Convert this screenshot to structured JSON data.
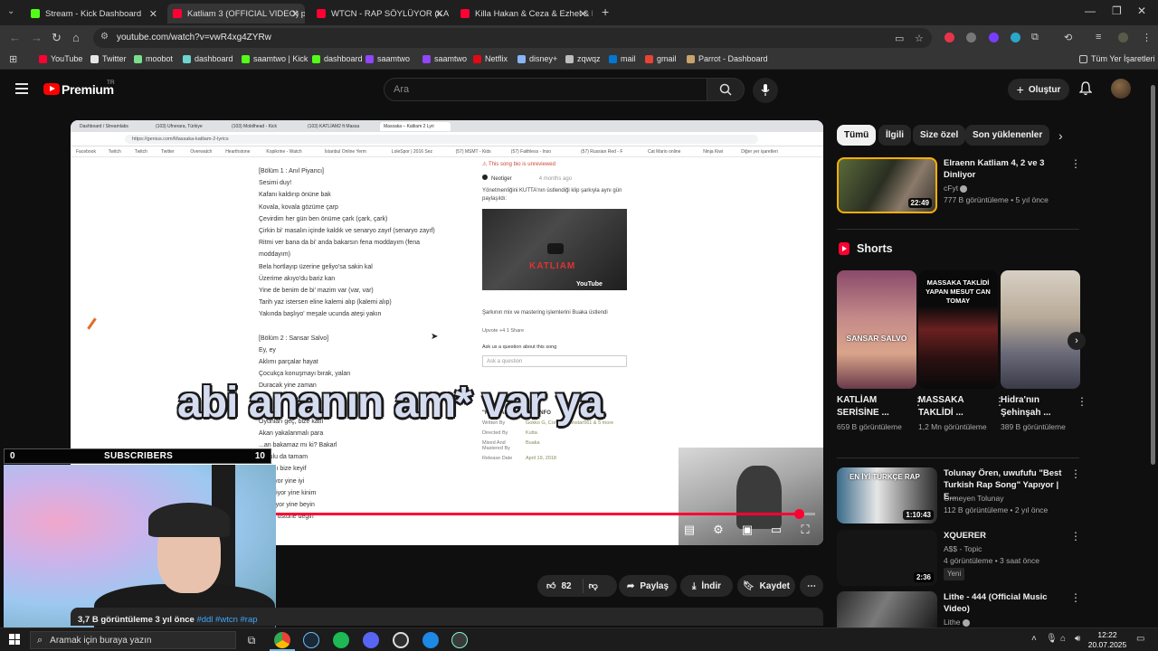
{
  "browser": {
    "tabs": [
      {
        "title": "Stream - Kick Dashboard",
        "active": false,
        "color": "#53fc18"
      },
      {
        "title": "Katliam 3 (OFFICIAL VIDEO) pro",
        "active": true,
        "color": "#ff0033"
      },
      {
        "title": "WTCN - RAP SÖYLÜYOR (KATLİ",
        "active": false,
        "color": "#ff0033"
      },
      {
        "title": "Killa Hakan & Ceza & Ezhel & B",
        "active": false,
        "color": "#ff0033"
      }
    ],
    "url": "youtube.com/watch?v=vwR4xg4ZYRw",
    "bookmarks": [
      {
        "label": "YouTube",
        "color": "#ff0033"
      },
      {
        "label": "Twitter",
        "color": "#e6e6e6"
      },
      {
        "label": "moobot",
        "color": "#7adf8a"
      },
      {
        "label": "dashboard",
        "color": "#6fd3d0"
      },
      {
        "label": "saamtwo | Kick",
        "color": "#53fc18"
      },
      {
        "label": "dashboard",
        "color": "#53fc18"
      },
      {
        "label": "saamtwo",
        "color": "#9146ff"
      },
      {
        "label": "saamtwo",
        "color": "#9146ff"
      },
      {
        "label": "Netflix",
        "color": "#e50914"
      },
      {
        "label": "disney+",
        "color": "#8ab4f8"
      },
      {
        "label": "zqwqz",
        "color": "#bdbdbd"
      },
      {
        "label": "mail",
        "color": "#0078d4"
      },
      {
        "label": "gmail",
        "color": "#ea4335"
      },
      {
        "label": "Parrot - Dashboard",
        "color": "#c8a46b"
      }
    ],
    "all_bookmarks": "Tüm Yer İşaretleri"
  },
  "header": {
    "brand": "Premium",
    "country": "TR",
    "search_placeholder": "Ara",
    "create_label": "Oluştur"
  },
  "player": {
    "inner_url": "https://genius.com/Massaka-katliam-2-lyrics",
    "inner_tabs": [
      "Dashboard / Streamlabs",
      "(103) Ufnerara, Türkiye",
      "(103) Mobilhead - Kick",
      "(103) KATLİAM2 ft Massa",
      "Massaka – Katliam 2 Lyri"
    ],
    "inner_bookmarks": [
      "Facebook",
      "Twitch",
      "Twitch",
      "Twitter",
      "Overwatch",
      "Hearthstone",
      "Kopikrine - Watch",
      "İstanbul Online Yerm",
      "LoleSpor | 2016 Sez",
      "(57) MSMT - Kids",
      "(57) Faithless - Inso",
      "(57) Russian Red - F",
      "Cat Mario online",
      "Ninja Kiwi",
      "Diğer yer işaretleri"
    ],
    "lyrics": [
      "[Bölüm 1 : Anıl Piyancı]",
      "Sesimi duy!",
      "Kafanı kaldırıp önüne bak",
      "Kovala, kovala gözüme çarp",
      "Çevirdim her gün ben önüme çark (çark, çark)",
      "Çirkin bi' masalın içinde kaldık ve senaryo zayıf (senaryo zayıf)",
      "Ritmi ver bana da bi' anda bakarsın fena moddayım (fena",
      "moddayım)",
      "Bela hortlayıp üzerine geliyo'sa sakin kal",
      "Üzerime akıyo'du bariz kan",
      "Yine de benim de bi' mazim var (var, var)",
      "Tarih yaz istersen eline kalemi alıp (kalemi alıp)",
      "Yakında başlıyo' meşale ucunda ateşi yakın",
      "",
      "[Bölüm 2 : Sansar Salvo]",
      "Ey, ey",
      "Aklımı parçalar hayat",
      "Çocukça konuşmayı bırak, yalan",
      "Duracak yine zaman",
      "",
      "",
      "Oyunları geç, bize katıl",
      "Akan yakalanmalı para",
      "...an bakamaz mı ki? Bakarl",
      "... bulu da tamam",
      "...larını bize keyif",
      "...üşüyor yine iyi",
      "... geçiyor yine kinim",
      "... geliyor yine beyin",
      "...imin üstüne değin"
    ],
    "bio_warning": "⚠ This song bio is unreviewed",
    "bio_author": "Neotiger",
    "bio_date": "4 months ago",
    "bio_text": "Yönetmenliğini KUTTA'nın üstlendiği klip şarkıyla aynı gün paylaşıldı:",
    "thumb_title": "KATLIAM",
    "thumb_brand": "YouTube",
    "mix_text": "Şarkının mix ve mastering işlemlerini Buaka üstlendi",
    "votes": "Upvote  +4    1   Share",
    "ask_label": "Ask us a question about this song",
    "ask_placeholder": "Ask a question",
    "track_info_title": "\"KATLIAM 2\" TRACK INFO",
    "track_info": [
      {
        "k": "Written By",
        "v": "Gokko G, Contra, Monstar561 & 5 more"
      },
      {
        "k": "Directed By",
        "v": "Kutta"
      },
      {
        "k": "Mixed And Mastered By",
        "v": "Buaka"
      },
      {
        "k": "Release Date",
        "v": "April 19, 2018"
      }
    ],
    "caption": "abi ananın am* var ya",
    "progress": 0.97
  },
  "overlay": {
    "sub_left": "0",
    "sub_label": "SUBSCRIBERS",
    "sub_right": "10"
  },
  "actions": {
    "likes": "82",
    "share": "Paylaş",
    "download": "İndir",
    "save": "Kaydet"
  },
  "description": {
    "views": "3,7 B görüntüleme  3 yıl önce",
    "tags": "#ddl #wtcn #rap"
  },
  "sidebar": {
    "chips": [
      "Tümü",
      "İlgili",
      "Size özel",
      "Son yüklenenler"
    ],
    "top_video": {
      "title": "Elraenn Katliam 4, 2 ve 3 Dinliyor",
      "channel": "cFyt",
      "meta": "777 B görüntüleme • 5 yıl önce",
      "duration": "22:49"
    },
    "shorts_title": "Shorts",
    "shorts": [
      {
        "overlay": "SANSAR SALVO",
        "title": "KATLİAM SERİSİNE ...",
        "views": "659 B görüntüleme"
      },
      {
        "overlay": "MASSAKA TAKLİDİ YAPAN MESUT CAN TOMAY",
        "title": "MASSAKA TAKLİDİ ...",
        "views": "1,2 Mn görüntüleme"
      },
      {
        "overlay": "",
        "title": "Hidra'nın Şehinşah ...",
        "views": "389 B görüntüleme"
      }
    ],
    "videos": [
      {
        "title": "Tolunay Ören, uwufufu \"Best Turkish Rap Song\" Yapıyor | E...",
        "channel": "Örmeyen Tolunay",
        "meta": "112 B görüntüleme • 2 yıl önce",
        "duration": "1:10:43",
        "thumb_text": "EN İYİ TÜRKÇE RAP"
      },
      {
        "title": "XQUERER",
        "channel": "A$$ - Topic",
        "meta": "4 görüntüleme • 3 saat önce",
        "duration": "2:36",
        "badge": "Yeni"
      },
      {
        "title": "Lithe - 444 (Official Music Video)",
        "channel": "Lithe",
        "meta": "",
        "duration": ""
      }
    ]
  },
  "taskbar": {
    "search_placeholder": "Aramak için buraya yazın",
    "time": "12:22",
    "date": "20.07.2025",
    "apps": [
      {
        "name": "task-view",
        "color": "#3a3a3a"
      },
      {
        "name": "chrome",
        "color": "#4285f4"
      },
      {
        "name": "steam",
        "color": "#1b2838"
      },
      {
        "name": "spotify",
        "color": "#1db954"
      },
      {
        "name": "discord",
        "color": "#5865f2"
      },
      {
        "name": "obs",
        "color": "#302e31"
      },
      {
        "name": "ccleaner",
        "color": "#1e88e5"
      },
      {
        "name": "streamlabs",
        "color": "#80f5d2"
      }
    ]
  }
}
